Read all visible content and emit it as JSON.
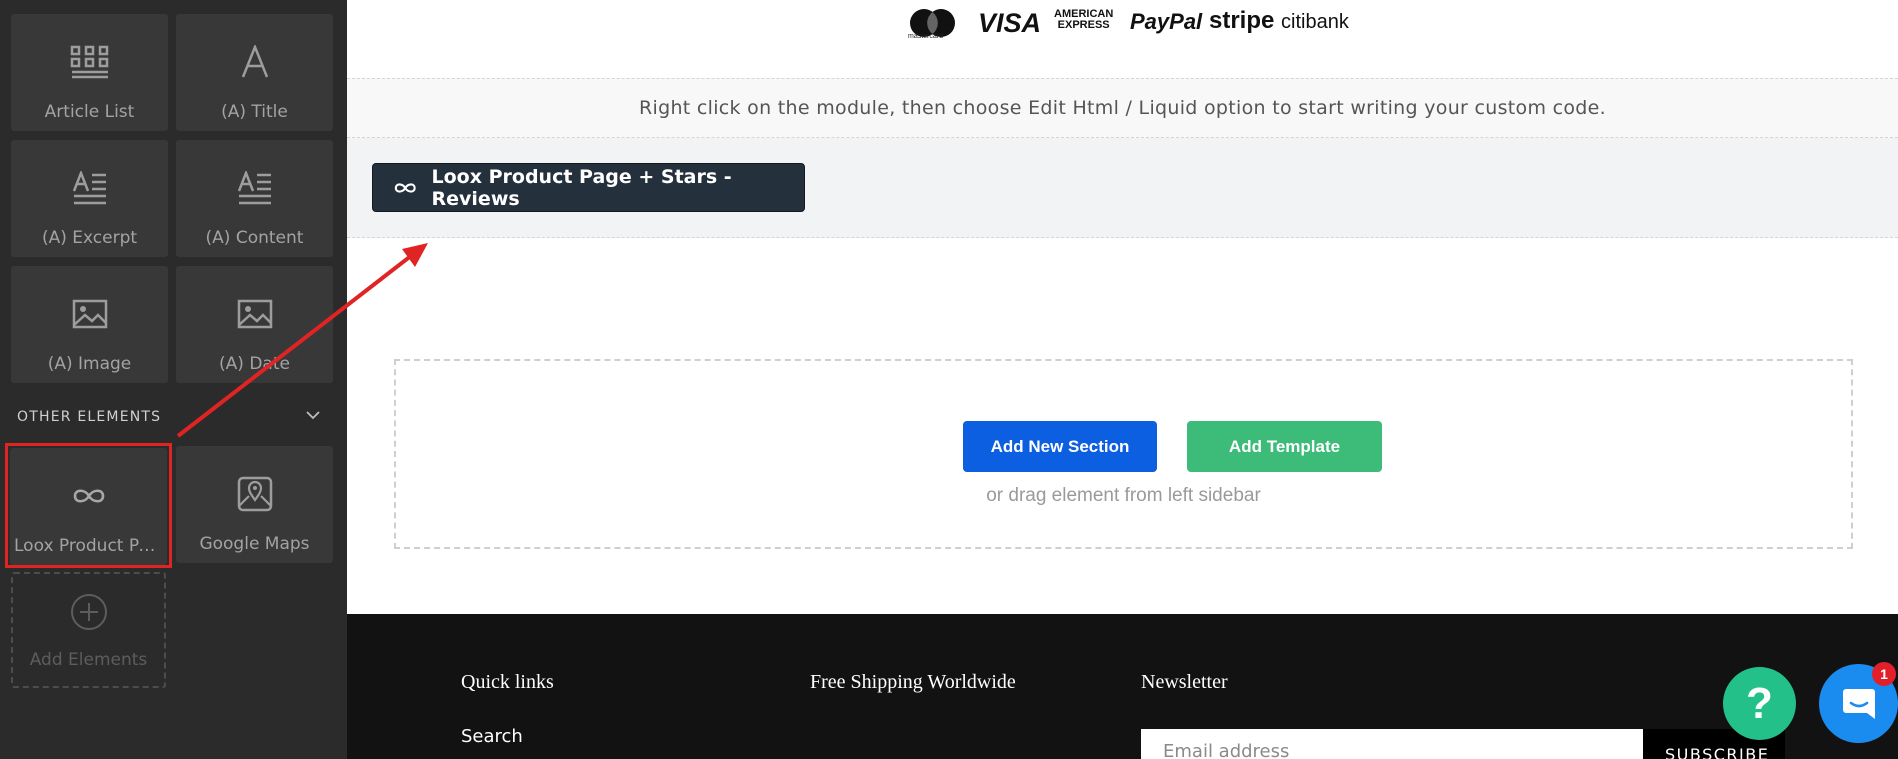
{
  "sidebar": {
    "elements": [
      {
        "label": "Article List",
        "icon": "article-list-icon"
      },
      {
        "label": "(A) Title",
        "icon": "title-letter-icon"
      },
      {
        "label": "(A) Excerpt",
        "icon": "excerpt-text-icon"
      },
      {
        "label": "(A) Content",
        "icon": "content-text-icon"
      },
      {
        "label": "(A) Image",
        "icon": "image-icon"
      },
      {
        "label": "(A) Date",
        "icon": "image-icon"
      }
    ],
    "other_section_title": "OTHER ELEMENTS",
    "other_elements": [
      {
        "label": "Loox Product Pag...",
        "icon": "infinity-icon"
      },
      {
        "label": "Google Maps",
        "icon": "map-icon"
      }
    ],
    "add_elements_label": "Add Elements"
  },
  "payments": {
    "mastercard_word": "mastercard",
    "visa": "VISA",
    "amex_line1": "AMERICAN",
    "amex_line2": "EXPRESS",
    "paypal": "PayPal",
    "stripe": "stripe",
    "citibank": "citibank"
  },
  "info_text": "Right click on the module, then choose Edit Html / Liquid option to start writing your custom code.",
  "module_button_label": "Loox Product Page + Stars - Reviews",
  "dropzone": {
    "add_section_label": "Add New Section",
    "add_template_label": "Add Template",
    "hint": "or drag element from left sidebar"
  },
  "footer": {
    "quick_links": "Quick links",
    "shipping": "Free Shipping Worldwide",
    "newsletter": "Newsletter",
    "search_link": "Search",
    "email_placeholder": "Email address",
    "subscribe_label": "SUBSCRIBE"
  },
  "help_label": "?",
  "chat_badge_count": "1",
  "colors": {
    "sidebar_bg": "#2b2b2b",
    "tile_bg": "#383838",
    "highlight": "#e02424",
    "module_button": "#25303d",
    "add_section": "#0b5fe0",
    "add_template": "#3dbb79",
    "help": "#23c08a",
    "chat": "#1a8cf0"
  }
}
